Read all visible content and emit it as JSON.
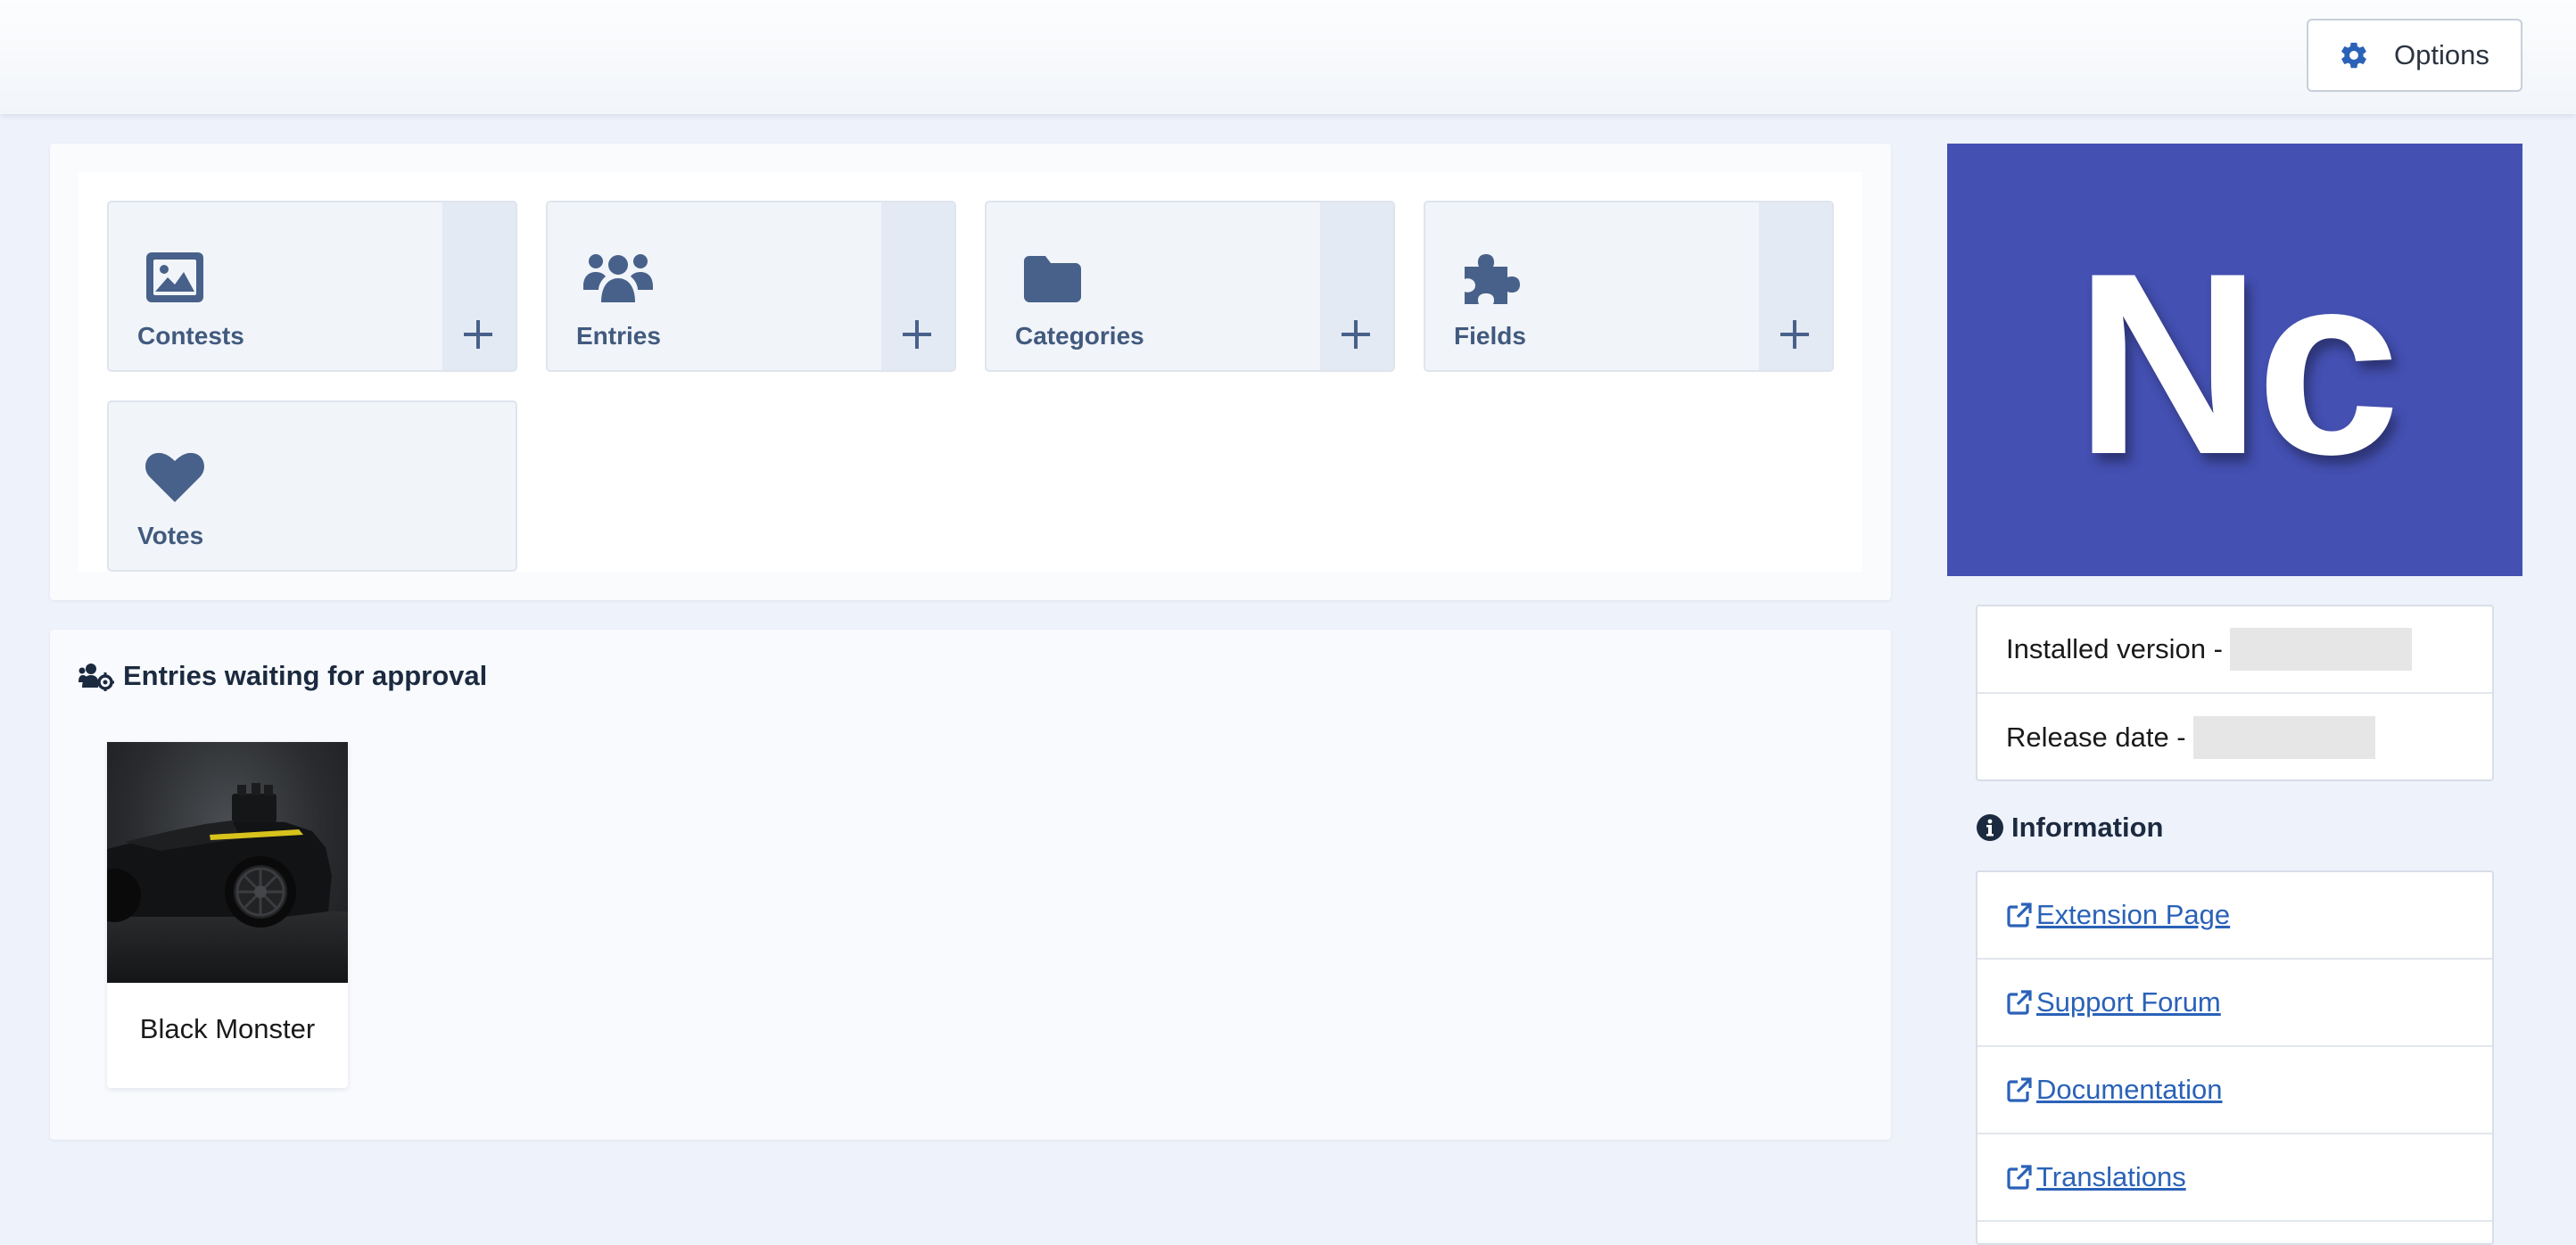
{
  "toolbar": {
    "options_label": "Options"
  },
  "dashboard": {
    "tiles": [
      {
        "label": "Contests",
        "icon": "image-icon",
        "has_add": true
      },
      {
        "label": "Entries",
        "icon": "users-icon",
        "has_add": true
      },
      {
        "label": "Categories",
        "icon": "folder-icon",
        "has_add": true
      },
      {
        "label": "Fields",
        "icon": "puzzle-icon",
        "has_add": true
      },
      {
        "label": "Votes",
        "icon": "heart-icon",
        "has_add": false
      }
    ]
  },
  "approval": {
    "title": "Entries waiting for approval",
    "entries": [
      {
        "name": "Black Monster"
      }
    ]
  },
  "sidebar": {
    "logo_text": "Nc",
    "logo_color": "#4450b2",
    "installed_version_label": "Installed version -",
    "release_date_label": "Release date -",
    "information_title": "Information",
    "links": [
      {
        "label": "Extension Page"
      },
      {
        "label": "Support Forum"
      },
      {
        "label": "Documentation"
      },
      {
        "label": "Translations"
      }
    ]
  },
  "colors": {
    "tile_icon": "#48618a",
    "link": "#2a62b8"
  }
}
